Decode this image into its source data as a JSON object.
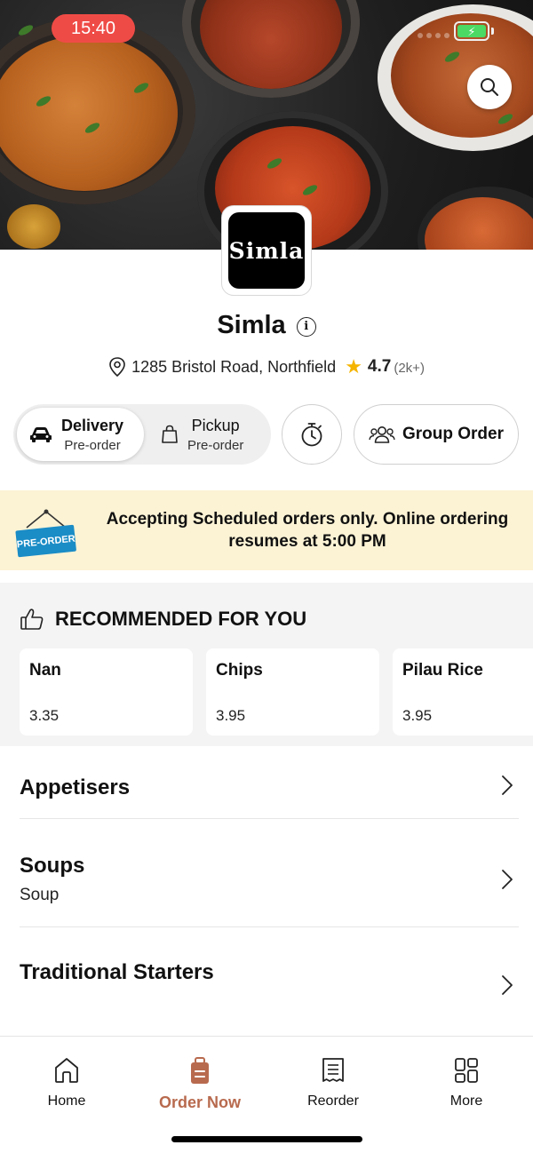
{
  "status_bar": {
    "time": "15:40",
    "battery_icon": "battery-charging-icon"
  },
  "store": {
    "name": "Simla",
    "logo_text": "Simla",
    "address": "1285 Bristol Road, Northfield",
    "rating": "4.7",
    "rating_count": "(2k+)"
  },
  "order_type": {
    "delivery_label": "Delivery",
    "delivery_sub": "Pre-order",
    "pickup_label": "Pickup",
    "pickup_sub": "Pre-order",
    "selected": "Delivery"
  },
  "group_order_label": "Group Order",
  "banner": {
    "tag_text": "PRE-ORDER",
    "message": "Accepting Scheduled orders only. Online ordering resumes at 5:00 PM"
  },
  "recommended": {
    "title": "RECOMMENDED FOR YOU",
    "items": [
      {
        "name": "Nan",
        "price": "3.35"
      },
      {
        "name": "Chips",
        "price": "3.95"
      },
      {
        "name": "Pilau Rice",
        "price": "3.95"
      }
    ]
  },
  "categories": [
    {
      "title": "Appetisers",
      "subtitle": ""
    },
    {
      "title": "Soups",
      "subtitle": "Soup"
    },
    {
      "title": "Traditional Starters",
      "subtitle": ""
    }
  ],
  "tabs": [
    {
      "label": "Home",
      "icon": "home-icon"
    },
    {
      "label": "Order Now",
      "icon": "order-bag-icon"
    },
    {
      "label": "Reorder",
      "icon": "receipt-icon"
    },
    {
      "label": "More",
      "icon": "grid-icon"
    }
  ],
  "colors": {
    "accent": "#b86a4e",
    "banner_bg": "#fcf3d5",
    "time_pill": "#ef4b46",
    "star": "#f5b400"
  }
}
